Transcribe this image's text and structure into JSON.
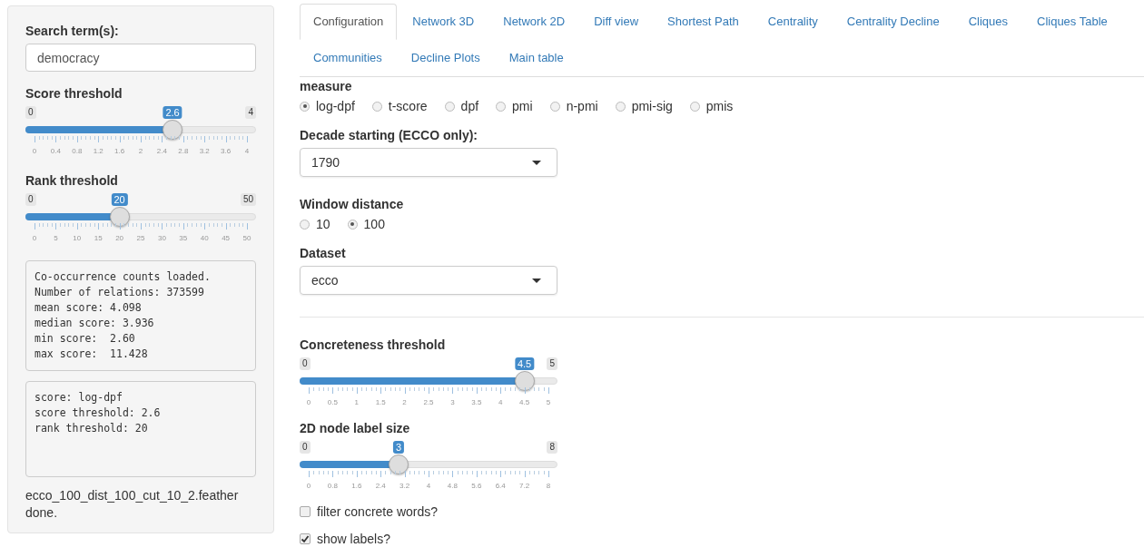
{
  "sidebar": {
    "search": {
      "label": "Search term(s):",
      "value": "democracy"
    },
    "sliders": [
      {
        "label": "Score threshold",
        "min": "0",
        "max": "4",
        "value": "2.6",
        "level": 0.65,
        "ticks": [
          "0",
          "0.4",
          "0.8",
          "1.2",
          "1.6",
          "2",
          "2.4",
          "2.8",
          "3.2",
          "3.6",
          "4"
        ]
      },
      {
        "label": "Rank threshold",
        "min": "0",
        "max": "50",
        "value": "20",
        "level": 0.4,
        "ticks": [
          "0",
          "5",
          "10",
          "15",
          "20",
          "25",
          "30",
          "35",
          "40",
          "45",
          "50"
        ]
      }
    ],
    "outputs": [
      {
        "lines": [
          "Co-occurrence counts loaded.",
          "Number of relations: 373599",
          "mean score: 4.098",
          "median score: 3.936",
          "min score:  2.60",
          "max score:  11.428"
        ]
      },
      {
        "lines": [
          "score: log-dpf",
          "score threshold: 2.6",
          "rank threshold: 20"
        ]
      }
    ],
    "status": [
      "ecco_100_dist_100_cut_10_2.feather",
      "done."
    ]
  },
  "tabs": [
    [
      {
        "label": "Configuration",
        "selected": true
      },
      {
        "label": "Network 3D",
        "selected": false
      },
      {
        "label": "Network 2D",
        "selected": false
      },
      {
        "label": "Diff view",
        "selected": false
      },
      {
        "label": "Shortest Path",
        "selected": false
      },
      {
        "label": "Centrality",
        "selected": false
      },
      {
        "label": "Centrality Decline",
        "selected": false
      },
      {
        "label": "Cliques",
        "selected": false
      },
      {
        "label": "Cliques Table",
        "selected": false
      }
    ],
    [
      {
        "label": "Communities",
        "selected": false
      },
      {
        "label": "Decline Plots",
        "selected": false
      },
      {
        "label": "Main table",
        "selected": false
      }
    ]
  ],
  "main": {
    "measure": {
      "label": "measure",
      "options": [
        {
          "label": "log-dpf",
          "selected": true
        },
        {
          "label": "t-score",
          "selected": false
        },
        {
          "label": "dpf",
          "selected": false
        },
        {
          "label": "pmi",
          "selected": false
        },
        {
          "label": "n-pmi",
          "selected": false
        },
        {
          "label": "pmi-sig",
          "selected": false
        },
        {
          "label": "pmis",
          "selected": false
        }
      ]
    },
    "decade": {
      "label": "Decade starting (ECCO only):",
      "value": "1790"
    },
    "window_distance": {
      "label": "Window distance",
      "options": [
        {
          "label": "10",
          "selected": false
        },
        {
          "label": "100",
          "selected": true
        }
      ]
    },
    "dataset": {
      "label": "Dataset",
      "value": "ecco"
    },
    "sliders": [
      {
        "label": "Concreteness threshold",
        "min": "0",
        "max": "5",
        "value": "4.5",
        "level": 0.9,
        "ticks": [
          "0",
          "0.5",
          "1",
          "1.5",
          "2",
          "2.5",
          "3",
          "3.5",
          "4",
          "4.5",
          "5"
        ]
      },
      {
        "label": "2D node label size",
        "min": "0",
        "max": "8",
        "value": "3",
        "level": 0.375,
        "ticks": [
          "0",
          "0.8",
          "1.6",
          "2.4",
          "3.2",
          "4",
          "4.8",
          "5.6",
          "6.4",
          "7.2",
          "8"
        ]
      }
    ],
    "checkboxes": [
      {
        "label": "filter concrete words?",
        "checked": false
      },
      {
        "label": "show labels?",
        "checked": true
      }
    ]
  }
}
